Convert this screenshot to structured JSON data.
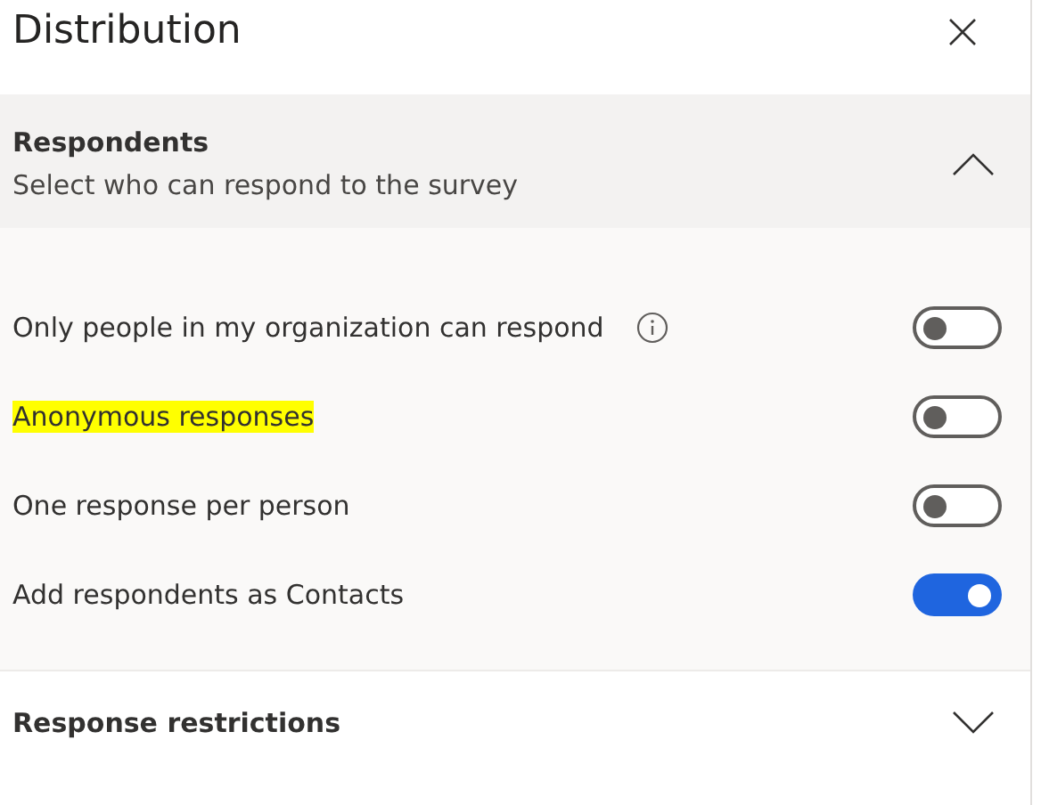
{
  "panel": {
    "title": "Distribution"
  },
  "sections": [
    {
      "title": "Respondents",
      "subtitle": "Select who can respond to the survey",
      "expanded": true,
      "options": [
        {
          "label": "Only people in my organization can respond",
          "info": true,
          "highlighted": false,
          "on": false
        },
        {
          "label": "Anonymous responses",
          "info": false,
          "highlighted": true,
          "on": false
        },
        {
          "label": "One response per person",
          "info": false,
          "highlighted": false,
          "on": false
        },
        {
          "label": "Add respondents as Contacts",
          "info": false,
          "highlighted": false,
          "on": true
        }
      ]
    },
    {
      "title": "Response restrictions",
      "expanded": false
    }
  ]
}
